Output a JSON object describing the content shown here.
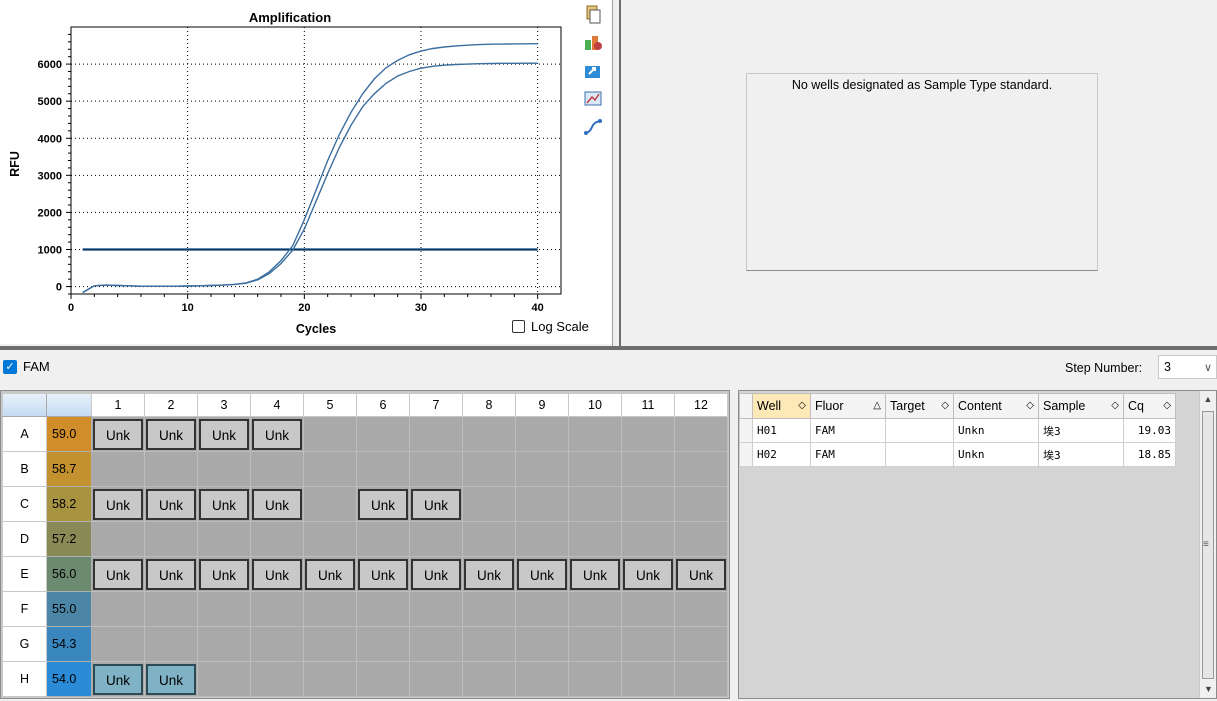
{
  "chart": {
    "title": "Amplification",
    "xlabel": "Cycles",
    "ylabel": "RFU",
    "log_scale_label": "Log Scale"
  },
  "chart_data": {
    "type": "line",
    "title": "Amplification",
    "xlabel": "Cycles",
    "ylabel": "RFU",
    "xlim": [
      0,
      42
    ],
    "ylim": [
      -200,
      7000
    ],
    "xticks": [
      0,
      10,
      20,
      30,
      40
    ],
    "yticks": [
      0,
      1000,
      2000,
      3000,
      4000,
      5000,
      6000
    ],
    "grid": true,
    "threshold": 1000,
    "series": [
      {
        "x": [
          1,
          2,
          3,
          4,
          5,
          6,
          7,
          8,
          9,
          10,
          11,
          12,
          13,
          14,
          15,
          16,
          17,
          18,
          19,
          20,
          21,
          22,
          23,
          24,
          25,
          26,
          27,
          28,
          29,
          30,
          31,
          32,
          33,
          34,
          35,
          36,
          37,
          38,
          39,
          40
        ],
        "values": [
          -160,
          20,
          40,
          30,
          20,
          10,
          10,
          10,
          10,
          15,
          20,
          30,
          40,
          60,
          100,
          200,
          400,
          700,
          1100,
          1800,
          2600,
          3400,
          4100,
          4700,
          5200,
          5600,
          5900,
          6100,
          6250,
          6350,
          6420,
          6460,
          6490,
          6510,
          6525,
          6535,
          6540,
          6545,
          6548,
          6550
        ]
      },
      {
        "x": [
          1,
          2,
          3,
          4,
          5,
          6,
          7,
          8,
          9,
          10,
          11,
          12,
          13,
          14,
          15,
          16,
          17,
          18,
          19,
          20,
          21,
          22,
          23,
          24,
          25,
          26,
          27,
          28,
          29,
          30,
          31,
          32,
          33,
          34,
          35,
          36,
          37,
          38,
          39,
          40
        ],
        "values": [
          -160,
          20,
          40,
          30,
          20,
          10,
          10,
          10,
          10,
          15,
          20,
          30,
          40,
          60,
          90,
          180,
          350,
          620,
          980,
          1550,
          2300,
          3050,
          3750,
          4350,
          4850,
          5200,
          5480,
          5680,
          5800,
          5890,
          5940,
          5970,
          5990,
          6000,
          6010,
          6015,
          6020,
          6022,
          6024,
          6025
        ]
      }
    ]
  },
  "std_curve": {
    "message": "No wells designated as Sample Type standard."
  },
  "fluor": {
    "label": "FAM",
    "checked": true
  },
  "step": {
    "label": "Step Number:",
    "value": "3"
  },
  "plate": {
    "columns": [
      "1",
      "2",
      "3",
      "4",
      "5",
      "6",
      "7",
      "8",
      "9",
      "10",
      "11",
      "12"
    ],
    "rows": [
      {
        "label": "A",
        "temp": "59.0",
        "color": "#d28d2b",
        "wells": [
          "Unk",
          "Unk",
          "Unk",
          "Unk",
          "",
          "",
          "",
          "",
          "",
          "",
          "",
          ""
        ]
      },
      {
        "label": "B",
        "temp": "58.7",
        "color": "#c3912f",
        "wells": [
          "",
          "",
          "",
          "",
          "",
          "",
          "",
          "",
          "",
          "",
          "",
          ""
        ]
      },
      {
        "label": "C",
        "temp": "58.2",
        "color": "#a79340",
        "wells": [
          "Unk",
          "Unk",
          "Unk",
          "Unk",
          "",
          "Unk",
          "Unk",
          "",
          "",
          "",
          "",
          ""
        ]
      },
      {
        "label": "D",
        "temp": "57.2",
        "color": "#8a8a57",
        "wells": [
          "",
          "",
          "",
          "",
          "",
          "",
          "",
          "",
          "",
          "",
          "",
          ""
        ]
      },
      {
        "label": "E",
        "temp": "56.0",
        "color": "#6c8a6f",
        "wells": [
          "Unk",
          "Unk",
          "Unk",
          "Unk",
          "Unk",
          "Unk",
          "Unk",
          "Unk",
          "Unk",
          "Unk",
          "Unk",
          "Unk"
        ]
      },
      {
        "label": "F",
        "temp": "55.0",
        "color": "#4c86a6",
        "wells": [
          "",
          "",
          "",
          "",
          "",
          "",
          "",
          "",
          "",
          "",
          "",
          ""
        ]
      },
      {
        "label": "G",
        "temp": "54.3",
        "color": "#3a87bf",
        "wells": [
          "",
          "",
          "",
          "",
          "",
          "",
          "",
          "",
          "",
          "",
          "",
          ""
        ]
      },
      {
        "label": "H",
        "temp": "54.0",
        "color": "#2b8bd6",
        "wells": [
          "Unk",
          "Unk",
          "",
          "",
          "",
          "",
          "",
          "",
          "",
          "",
          "",
          ""
        ]
      }
    ],
    "selected_wells": [
      "H1",
      "H2"
    ]
  },
  "wells_table": {
    "headers": [
      "Well",
      "Fluor",
      "Target",
      "Content",
      "Sample",
      "Cq"
    ],
    "rows": [
      [
        "H01",
        "FAM",
        "",
        "Unkn",
        "埃3",
        "19.03"
      ],
      [
        "H02",
        "FAM",
        "",
        "Unkn",
        "埃3",
        "18.85"
      ]
    ]
  }
}
